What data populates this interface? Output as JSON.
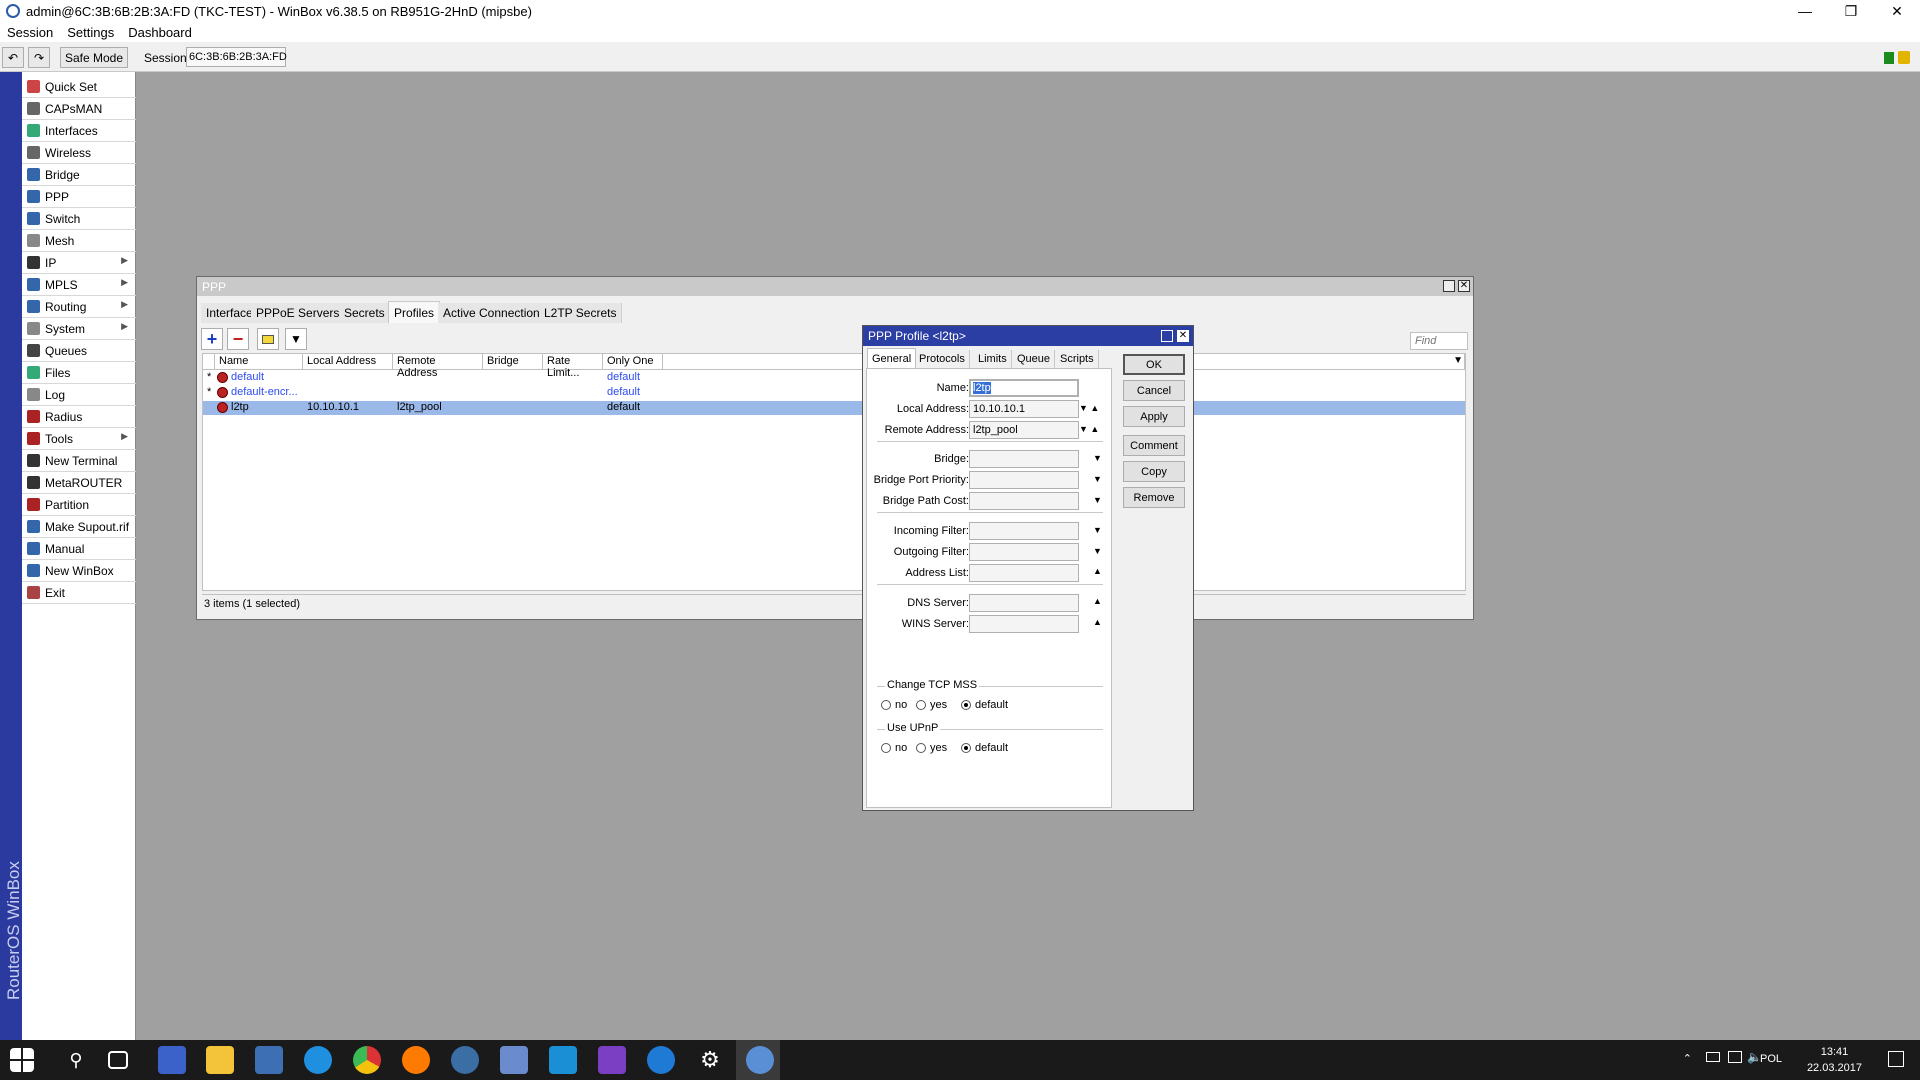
{
  "title": "admin@6C:3B:6B:2B:3A:FD (TKC-TEST) - WinBox v6.38.5 on RB951G-2HnD (mipsbe)",
  "menu": [
    "Session",
    "Settings",
    "Dashboard"
  ],
  "toolbar": {
    "safe_mode": "Safe Mode",
    "session_label": "Session:",
    "session_value": "6C:3B:6B:2B:3A:FD"
  },
  "sidebar": {
    "brand": "RouterOS WinBox",
    "items": [
      {
        "label": "Quick Set",
        "icon": "quick-set-icon",
        "arrow": false
      },
      {
        "label": "CAPsMAN",
        "icon": "capsman-icon",
        "arrow": false
      },
      {
        "label": "Interfaces",
        "icon": "interfaces-icon",
        "arrow": false
      },
      {
        "label": "Wireless",
        "icon": "wireless-icon",
        "arrow": false
      },
      {
        "label": "Bridge",
        "icon": "bridge-icon",
        "arrow": false
      },
      {
        "label": "PPP",
        "icon": "ppp-icon",
        "arrow": false
      },
      {
        "label": "Switch",
        "icon": "switch-icon",
        "arrow": false
      },
      {
        "label": "Mesh",
        "icon": "mesh-icon",
        "arrow": false
      },
      {
        "label": "IP",
        "icon": "ip-icon",
        "arrow": true
      },
      {
        "label": "MPLS",
        "icon": "mpls-icon",
        "arrow": true
      },
      {
        "label": "Routing",
        "icon": "routing-icon",
        "arrow": true
      },
      {
        "label": "System",
        "icon": "system-icon",
        "arrow": true
      },
      {
        "label": "Queues",
        "icon": "queues-icon",
        "arrow": false
      },
      {
        "label": "Files",
        "icon": "files-icon",
        "arrow": false
      },
      {
        "label": "Log",
        "icon": "log-icon",
        "arrow": false
      },
      {
        "label": "Radius",
        "icon": "radius-icon",
        "arrow": false
      },
      {
        "label": "Tools",
        "icon": "tools-icon",
        "arrow": true
      },
      {
        "label": "New Terminal",
        "icon": "terminal-icon",
        "arrow": false
      },
      {
        "label": "MetaROUTER",
        "icon": "metarouter-icon",
        "arrow": false
      },
      {
        "label": "Partition",
        "icon": "partition-icon",
        "arrow": false
      },
      {
        "label": "Make Supout.rif",
        "icon": "supout-icon",
        "arrow": false
      },
      {
        "label": "Manual",
        "icon": "manual-icon",
        "arrow": false
      },
      {
        "label": "New WinBox",
        "icon": "winbox-icon",
        "arrow": false
      },
      {
        "label": "Exit",
        "icon": "exit-icon",
        "arrow": false
      }
    ]
  },
  "ppp": {
    "title": "PPP",
    "tabs": [
      "Interface",
      "PPPoE Servers",
      "Secrets",
      "Profiles",
      "Active Connections",
      "L2TP Secrets"
    ],
    "active_tab": "Profiles",
    "find_placeholder": "Find",
    "columns": [
      "Name",
      "Local Address",
      "Remote Address",
      "Bridge",
      "Rate Limit...",
      "Only One"
    ],
    "rows": [
      {
        "marker": "*",
        "name": "default",
        "local": "",
        "remote": "",
        "bridge": "",
        "rate": "",
        "only_one": "default",
        "selected": false,
        "blue": true
      },
      {
        "marker": "*",
        "name": "default-encr...",
        "local": "",
        "remote": "",
        "bridge": "",
        "rate": "",
        "only_one": "default",
        "selected": false,
        "blue": true
      },
      {
        "marker": "",
        "name": "l2tp",
        "local": "10.10.10.1",
        "remote": "l2tp_pool",
        "bridge": "",
        "rate": "",
        "only_one": "default",
        "selected": true,
        "blue": false
      }
    ],
    "status": "3 items (1 selected)"
  },
  "dialog": {
    "title": "PPP Profile <l2tp>",
    "tabs": [
      "General",
      "Protocols",
      "Limits",
      "Queue",
      "Scripts"
    ],
    "fields": [
      {
        "label": "Name:",
        "value": "l2tp"
      },
      {
        "label": "Local Address:",
        "value": "10.10.10.1"
      },
      {
        "label": "Remote Address:",
        "value": "l2tp_pool"
      },
      {
        "label": "Bridge:",
        "value": ""
      },
      {
        "label": "Bridge Port Priority:",
        "value": ""
      },
      {
        "label": "Bridge Path Cost:",
        "value": ""
      },
      {
        "label": "Incoming Filter:",
        "value": ""
      },
      {
        "label": "Outgoing Filter:",
        "value": ""
      },
      {
        "label": "Address List:",
        "value": ""
      },
      {
        "label": "DNS Server:",
        "value": ""
      },
      {
        "label": "WINS Server:",
        "value": ""
      }
    ],
    "groups": [
      {
        "label": "Change TCP MSS",
        "options": [
          "no",
          "yes",
          "default"
        ],
        "selected": "default"
      },
      {
        "label": "Use UPnP",
        "options": [
          "no",
          "yes",
          "default"
        ],
        "selected": "default"
      }
    ],
    "buttons": [
      "OK",
      "Cancel",
      "Apply",
      "Comment",
      "Copy",
      "Remove"
    ]
  },
  "taskbar": {
    "language": "POL",
    "time": "13:41",
    "date": "22.03.2017"
  }
}
